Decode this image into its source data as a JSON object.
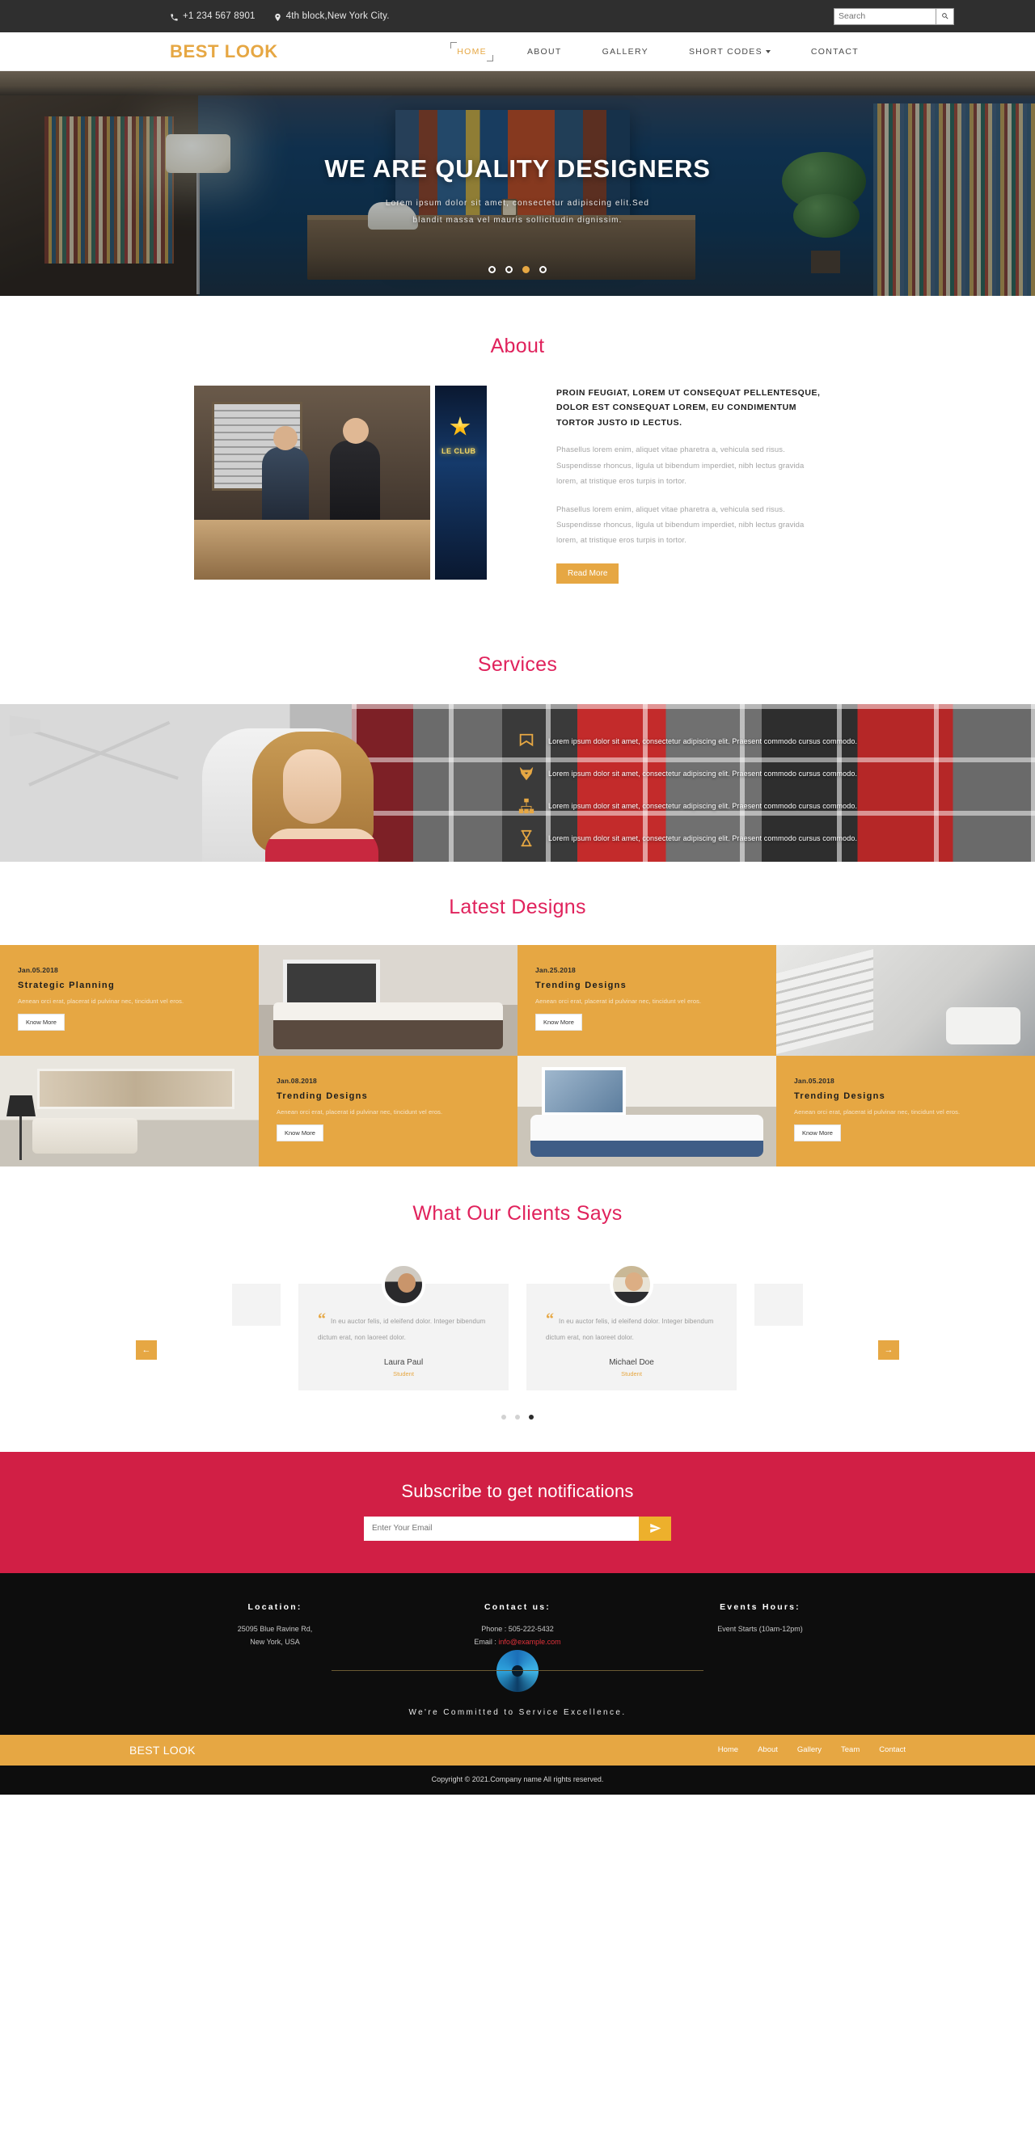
{
  "topbar": {
    "phone": "+1 234 567 8901",
    "address": "4th block,New York City.",
    "search_placeholder": "Search",
    "search_value": "",
    "phone_icon": "phone-icon",
    "location_icon": "map-pin-icon",
    "search_icon": "search-icon"
  },
  "nav": {
    "brand": "BEST LOOK",
    "items": [
      {
        "label": "HOME",
        "active": true,
        "caret": false
      },
      {
        "label": "ABOUT",
        "active": false,
        "caret": false
      },
      {
        "label": "GALLERY",
        "active": false,
        "caret": false
      },
      {
        "label": "SHORT CODES",
        "active": false,
        "caret": true
      },
      {
        "label": "CONTACT",
        "active": false,
        "caret": false
      }
    ]
  },
  "hero": {
    "title": "WE ARE QUALITY DESIGNERS",
    "subtitle_line1": "Lorem ipsum dolor sit amet, consectetur adipiscing elit.Sed",
    "subtitle_line2": "blandit massa vel mauris sollicitudin dignissim.",
    "dots": 4,
    "active_dot": 3
  },
  "about": {
    "heading": "About",
    "lead": "PROIN FEUGIAT, LOREM UT CONSEQUAT PELLENTESQUE, DOLOR EST CONSEQUAT LOREM, EU CONDIMENTUM TORTOR JUSTO ID LECTUS.",
    "paragraph1": "Phasellus lorem enim, aliquet vitae pharetra a, vehicula sed risus. Suspendisse rhoncus, ligula ut bibendum imperdiet, nibh lectus gravida lorem, at tristique eros turpis in tortor.",
    "paragraph2": "Phasellus lorem enim, aliquet vitae pharetra a, vehicula sed risus. Suspendisse rhoncus, ligula ut bibendum imperdiet, nibh lectus gravida lorem, at tristique eros turpis in tortor.",
    "button": "Read More",
    "image1_alt": "hotel-reception-photo",
    "image2_alt": "le-club-neon-sign-photo"
  },
  "services": {
    "heading": "Services",
    "items": [
      {
        "icon": "flag-banner-icon",
        "text": "Lorem ipsum dolor sit amet, consectetur adipiscing elit. Praesent commodo cursus commodo."
      },
      {
        "icon": "fox-head-icon",
        "text": "Lorem ipsum dolor sit amet, consectetur adipiscing elit. Praesent commodo cursus commodo."
      },
      {
        "icon": "sitemap-icon",
        "text": "Lorem ipsum dolor sit amet, consectetur adipiscing elit. Praesent commodo cursus commodo."
      },
      {
        "icon": "hourglass-icon",
        "text": "Lorem ipsum dolor sit amet, consectetur adipiscing elit. Praesent commodo cursus commodo."
      }
    ]
  },
  "latest": {
    "heading": "Latest Designs",
    "cards": [
      {
        "date": "Jan.05.2018",
        "title": "Strategic Planning",
        "desc": "Aenean orci erat, placerat id pulvinar nec, tincidunt vel eros.",
        "button": "Know More"
      },
      {
        "date": "Jan.25.2018",
        "title": "Trending Designs",
        "desc": "Aenean orci erat, placerat id pulvinar nec, tincidunt vel eros.",
        "button": "Know More"
      },
      {
        "date": "Jan.08.2018",
        "title": "Trending Designs",
        "desc": "Aenean orci erat, placerat id pulvinar nec, tincidunt vel eros.",
        "button": "Know More"
      },
      {
        "date": "Jan.05.2018",
        "title": "Trending Designs",
        "desc": "Aenean orci erat, placerat id pulvinar nec, tincidunt vel eros.",
        "button": "Know More"
      }
    ],
    "photos": [
      "bedroom-photo",
      "staircase-lobby-photo",
      "living-room-sofa-photo",
      "white-sofa-living-room-photo"
    ]
  },
  "testimonials": {
    "heading": "What Our Clients Says",
    "prev_label": "←",
    "next_label": "→",
    "items": [
      {
        "quote": "In eu auctor felis, id eleifend dolor. Integer bibendum dictum erat, non laoreet dolor.",
        "name": "Laura Paul",
        "role": "Student"
      },
      {
        "quote": "In eu auctor felis, id eleifend dolor. Integer bibendum dictum erat, non laoreet dolor.",
        "name": "Michael Doe",
        "role": "Student"
      }
    ],
    "dots": 3,
    "active_dot": 3
  },
  "subscribe": {
    "title": "Subscribe to get notifications",
    "placeholder": "Enter Your Email",
    "value": "",
    "submit_icon": "paper-plane-icon"
  },
  "footer": {
    "columns": [
      {
        "heading": "Location:",
        "line1": "25095 Blue Ravine Rd,",
        "line2": "New York, USA"
      },
      {
        "heading": "Contact us:",
        "line1": "Phone :  505-222-5432",
        "line2_label": "Email :",
        "email": "info@example.com"
      },
      {
        "heading": "Events Hours:",
        "line1": "Event Starts (10am-12pm)",
        "line2": ""
      }
    ],
    "logo_icon": "spiral-burst-logo-icon",
    "tagline": "We're Committed to Service Excellence.",
    "bar_brand": "BEST LOOK",
    "bar_links": [
      "Home",
      "About",
      "Gallery",
      "Team",
      "Contact"
    ],
    "copyright": "Copyright © 2021.Company name All rights reserved."
  },
  "colors": {
    "gold": "#e6a743",
    "pink": "#e0225c",
    "crimson": "#d11f45",
    "dark": "#0d0d0d",
    "topbar": "#2f2f2f"
  }
}
